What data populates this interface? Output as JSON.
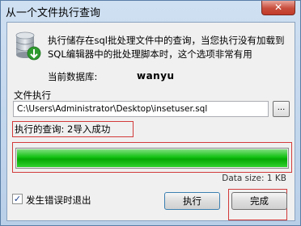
{
  "window": {
    "title": "从一个文件执行查询",
    "close_glyph": "✕"
  },
  "description": "执行储存在sql批处理文件中的查询，当您执行没有加载到SQL编辑器中的批处理脚本时，这个选项非常有用",
  "current_db": {
    "label": "当前数据库:",
    "value": "wanyu"
  },
  "file": {
    "label": "文件执行",
    "path": "C:\\Users\\Administrator\\Desktop\\insetuser.sql",
    "browse_label": "..."
  },
  "result_text": "执行的查询: 2导入成功",
  "progress": {
    "percent": 100,
    "color": "#10c010"
  },
  "data_size": "Data size: 1 KB",
  "stop_on_error": {
    "label": "发生错误时退出",
    "checked": true,
    "check_glyph": "✓"
  },
  "buttons": {
    "execute": "执行",
    "finish": "完成"
  },
  "icons": {
    "app": "database-icon"
  },
  "colors": {
    "highlight": "#d23a3a",
    "titlebar": "#cfe0f2",
    "close": "#c84d3c"
  }
}
